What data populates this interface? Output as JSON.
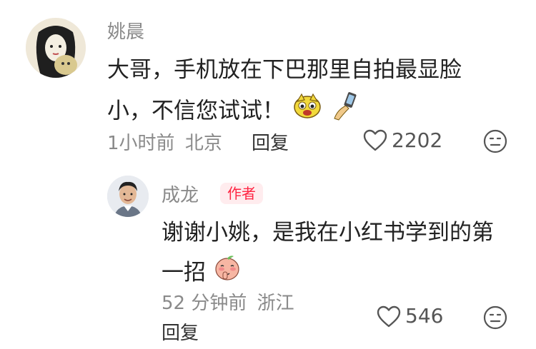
{
  "comments": [
    {
      "user": "姚晨",
      "text_line1": "大哥，手机放在下巴那里自拍最显脸",
      "text_line2": "小，不信您试试！",
      "time": "1小时前",
      "location": "北京",
      "reply_label": "回复",
      "likes": "2202",
      "emoji_names": [
        "dog-face-emoji",
        "selfie-emoji"
      ]
    },
    {
      "user": "成龙",
      "badge": "作者",
      "text_line1": "谢谢小姚，是我在小红书学到的第",
      "text_line2": "一招",
      "time": "52 分钟前",
      "location": "浙江",
      "reply_label": "回复",
      "likes": "546",
      "emoji_names": [
        "peach-shy-emoji"
      ]
    }
  ],
  "colors": {
    "accent": "#ff2442",
    "meta": "#8a8a8a",
    "badge_bg": "#ffecee"
  }
}
